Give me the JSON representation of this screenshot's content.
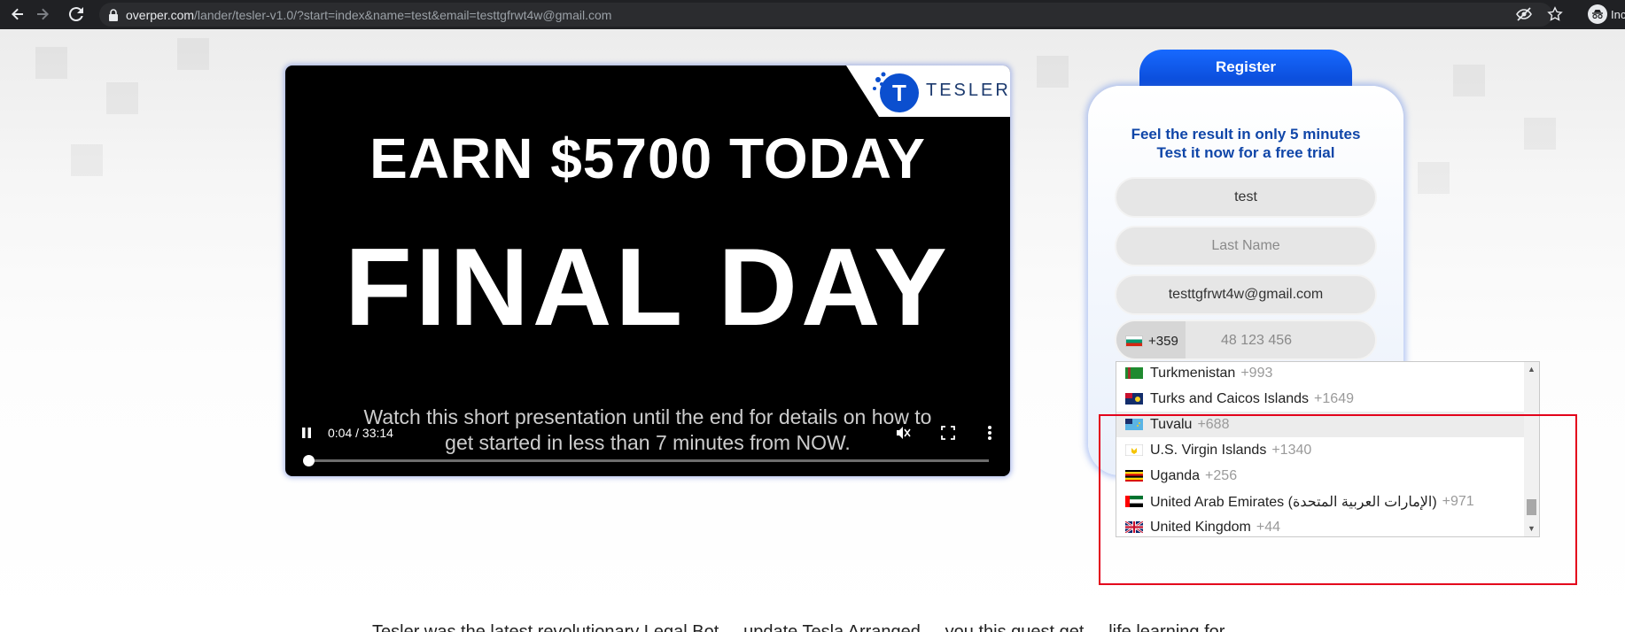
{
  "browser": {
    "url_host": "overper.com",
    "url_path": "/lander/tesler-v1.0/?start=index&name=test&email=testtgfrwt4w@gmail.com",
    "profile_label": "Inc",
    "icons": [
      "back-arrow-icon",
      "forward-arrow-icon",
      "reload-icon",
      "lock-icon",
      "eye-off-icon",
      "star-icon",
      "incognito-icon"
    ]
  },
  "video": {
    "brand": "TESLER",
    "brand_letter": "T",
    "headline": "EARN $5700 TODAY",
    "headline2": "FINAL DAY",
    "subtitle_line1": "Watch this short presentation until the end for details on how to",
    "subtitle_line2": "get started in less than 7 minutes from NOW.",
    "time": "0:04 / 33:14",
    "progress": 0.002
  },
  "form": {
    "tab_label": "Register",
    "tagline_line1": "Feel the result in only 5 minutes",
    "tagline_line2": "Test it now for a free trial",
    "first_name_value": "test",
    "last_name_placeholder": "Last Name",
    "email_value": "testtgfrwt4w@gmail.com",
    "phone_code": "+359",
    "phone_placeholder": "48 123 456"
  },
  "dropdown": {
    "items": [
      {
        "name": "Turkmenistan",
        "dial": "+993",
        "flag": "turkmenistan-flag-icon"
      },
      {
        "name": "Turks and Caicos Islands",
        "dial": "+1649",
        "flag": "turks-caicos-flag-icon"
      },
      {
        "name": "Tuvalu",
        "dial": "+688",
        "flag": "tuvalu-flag-icon"
      },
      {
        "name": "U.S. Virgin Islands",
        "dial": "+1340",
        "flag": "us-virgin-islands-flag-icon"
      },
      {
        "name": "Uganda",
        "dial": "+256",
        "flag": "uganda-flag-icon"
      },
      {
        "name": "United Arab Emirates (‫الإمارات العربية المتحدة‬‎)",
        "dial": "+971",
        "flag": "uae-flag-icon"
      },
      {
        "name": "United Kingdom",
        "dial": "+44",
        "flag": "uk-flag-icon"
      }
    ],
    "highlighted_index": 2
  },
  "colors": {
    "register_blue": "#0a4fe0",
    "tagline_blue": "#1046a8",
    "annotation_red": "#e3001b"
  },
  "footer": {
    "text": "Tesler was the latest revolutionary Legal Bot ... update Tesla Arranged ... you this quest get ... life learning for"
  }
}
